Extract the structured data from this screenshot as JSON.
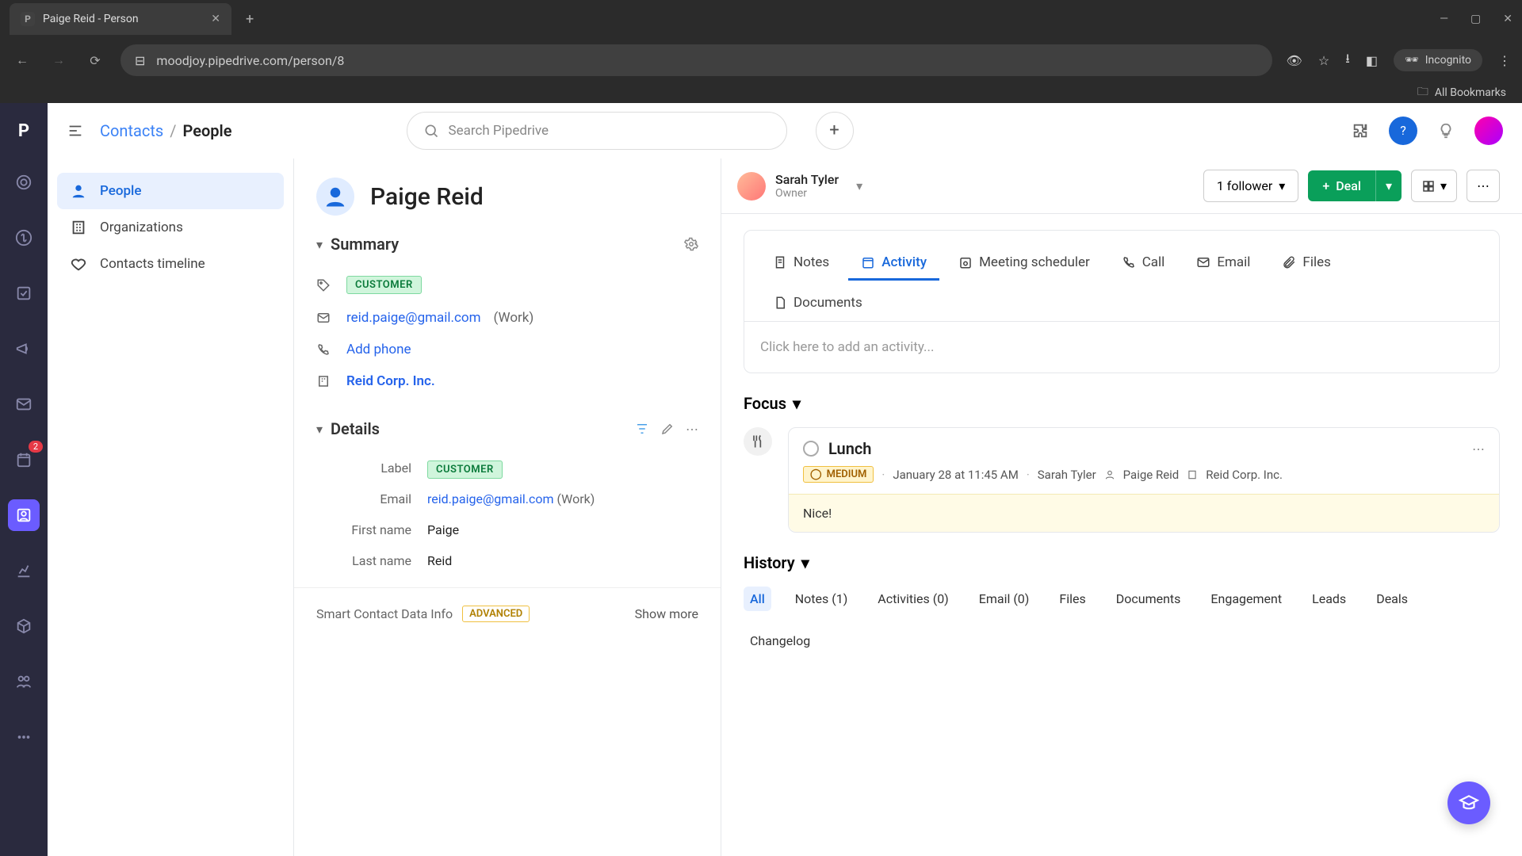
{
  "browser": {
    "tab_title": "Paige Reid - Person",
    "url": "moodjoy.pipedrive.com/person/8",
    "incognito_label": "Incognito",
    "bookmarks_label": "All Bookmarks"
  },
  "breadcrumb": {
    "root": "Contacts",
    "current": "People"
  },
  "search": {
    "placeholder": "Search Pipedrive"
  },
  "sidebar": {
    "items": [
      {
        "label": "People"
      },
      {
        "label": "Organizations"
      },
      {
        "label": "Contacts timeline"
      }
    ]
  },
  "rail": {
    "badge": "2"
  },
  "person": {
    "name": "Paige Reid",
    "owner_name": "Sarah Tyler",
    "owner_role": "Owner",
    "followers_label": "1 follower",
    "deal_label": "Deal"
  },
  "summary": {
    "title": "Summary",
    "tag": "CUSTOMER",
    "email": "reid.paige@gmail.com",
    "email_type": "(Work)",
    "add_phone": "Add phone",
    "org": "Reid Corp. Inc."
  },
  "details": {
    "title": "Details",
    "rows": {
      "label_label": "Label",
      "label_value": "CUSTOMER",
      "email_label": "Email",
      "email_value": "reid.paige@gmail.com",
      "email_type": "(Work)",
      "first_label": "First name",
      "first_value": "Paige",
      "last_label": "Last name",
      "last_value": "Reid"
    }
  },
  "smart": {
    "label": "Smart Contact Data Info",
    "chip": "ADVANCED",
    "show_more": "Show more"
  },
  "tabs": {
    "notes": "Notes",
    "activity": "Activity",
    "meeting": "Meeting scheduler",
    "call": "Call",
    "email": "Email",
    "files": "Files",
    "documents": "Documents",
    "placeholder": "Click here to add an activity..."
  },
  "focus": {
    "title": "Focus",
    "activity": {
      "title": "Lunch",
      "priority": "MEDIUM",
      "when": "January 28 at 11:45 AM",
      "who": "Sarah Tyler",
      "contact": "Paige Reid",
      "org": "Reid Corp. Inc.",
      "note": "Nice!"
    }
  },
  "history": {
    "title": "History",
    "tabs": {
      "all": "All",
      "notes": "Notes (1)",
      "activities": "Activities (0)",
      "email": "Email (0)",
      "files": "Files",
      "documents": "Documents",
      "engagement": "Engagement",
      "leads": "Leads",
      "deals": "Deals",
      "changelog": "Changelog"
    }
  }
}
